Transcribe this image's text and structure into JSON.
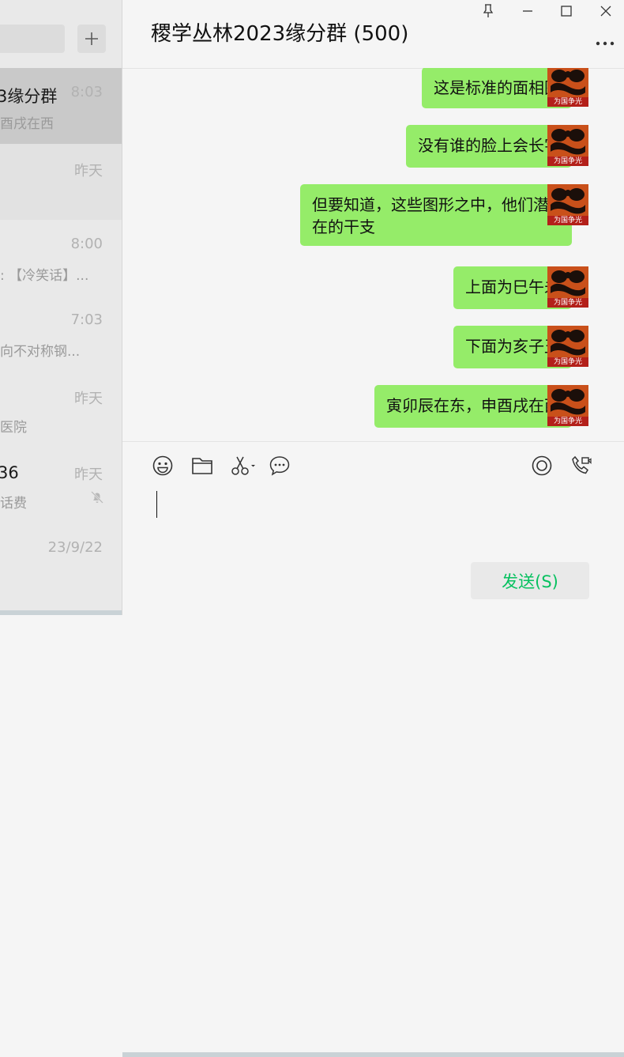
{
  "sidebar": {
    "add_label": "+",
    "chats": [
      {
        "name": "3缘分群",
        "time": "8:03",
        "preview": "酉戌在西",
        "active": true
      },
      {
        "name": "",
        "time": "昨天",
        "preview": ""
      },
      {
        "name": "",
        "time": "8:00",
        "preview": ": 【冷笑话】..."
      },
      {
        "name": "",
        "time": "7:03",
        "preview": "向不对称钢..."
      },
      {
        "name": "",
        "time": "昨天",
        "preview": "医院"
      },
      {
        "name": "36",
        "time": "昨天",
        "preview": "话费",
        "muted": true
      },
      {
        "name": "",
        "time": "23/9/22",
        "preview": ""
      }
    ]
  },
  "chat": {
    "title": "稷学丛林2023缘分群 (500)",
    "messages": [
      {
        "text": "这是标准的面相图"
      },
      {
        "text": "没有谁的脸上会长字"
      },
      {
        "text": "但要知道，这些图形之中，他们潜在的干支"
      },
      {
        "text": "上面为巳午未"
      },
      {
        "text": "下面为亥子丑"
      },
      {
        "text": "寅卯辰在东，申酉戌在西"
      }
    ],
    "avatar_caption": "为国争光"
  },
  "input": {
    "send_label": "发送(S)"
  },
  "colors": {
    "bubble": "#95ec69",
    "send_text": "#07c160",
    "avatar_bg": "#d4561a"
  },
  "icons": [
    "pin-icon",
    "minimize-icon",
    "maximize-icon",
    "close-icon",
    "more-icon",
    "emoji-icon",
    "folder-icon",
    "scissors-icon",
    "chat-history-icon",
    "live-icon",
    "video-call-icon",
    "mute-icon"
  ]
}
